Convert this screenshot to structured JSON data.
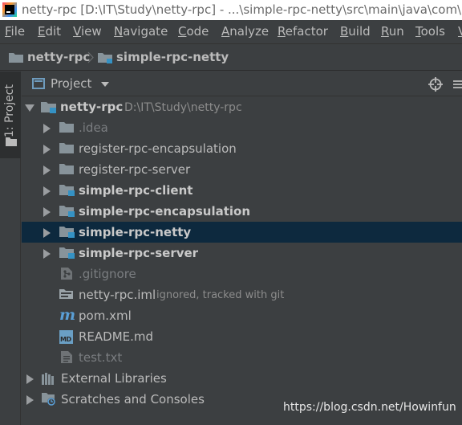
{
  "window": {
    "title": "netty-rpc [D:\\IT\\Study\\netty-rpc] - ...\\simple-rpc-netty\\src\\main\\java\\com\\hy"
  },
  "menu": [
    "File",
    "Edit",
    "View",
    "Navigate",
    "Code",
    "Analyze",
    "Refactor",
    "Build",
    "Run",
    "Tools",
    "V"
  ],
  "breadcrumb": [
    "netty-rpc",
    "simple-rpc-netty"
  ],
  "side_tab": {
    "label": "1: Project"
  },
  "project_panel": {
    "title": "Project"
  },
  "tree": {
    "root": {
      "name": "netty-rpc",
      "path": "D:\\IT\\Study\\netty-rpc"
    },
    "items": [
      {
        "name": ".idea"
      },
      {
        "name": "register-rpc-encapsulation"
      },
      {
        "name": "register-rpc-server"
      },
      {
        "name": "simple-rpc-client"
      },
      {
        "name": "simple-rpc-encapsulation"
      },
      {
        "name": "simple-rpc-netty",
        "selected": true
      },
      {
        "name": "simple-rpc-server"
      },
      {
        "name": ".gitignore"
      },
      {
        "name": "netty-rpc.iml",
        "hint": "ignored, tracked with git"
      },
      {
        "name": "pom.xml",
        "icon_letter": "m"
      },
      {
        "name": "README.md",
        "icon_letter": "MD"
      },
      {
        "name": "test.txt"
      },
      {
        "name": "External Libraries"
      },
      {
        "name": "Scratches and Consoles"
      }
    ]
  },
  "watermark": "https://blog.csdn.net/Howinfun",
  "colors": {
    "background": "#3c3f41",
    "selection": "#0d293e",
    "text": "#bbbbbb",
    "folder": "#87939a",
    "module_badge": "#3592c4"
  }
}
